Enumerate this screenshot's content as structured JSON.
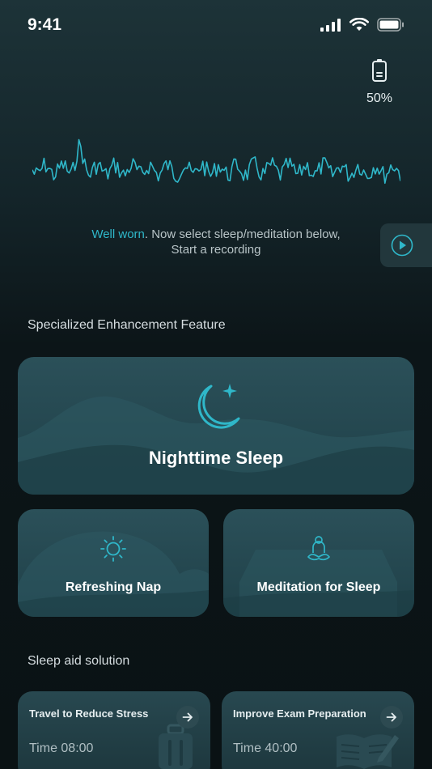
{
  "status_bar": {
    "time": "9:41"
  },
  "device": {
    "battery_percent": "50%"
  },
  "prompt": {
    "highlight": "Well worn",
    "line1_rest": ". Now select sleep/meditation below,",
    "line2": "Start a recording"
  },
  "sections": {
    "enhancement_title": "Specialized Enhancement Feature",
    "solution_title": "Sleep aid solution"
  },
  "features": {
    "nighttime": {
      "label": "Nighttime Sleep"
    },
    "nap": {
      "label": "Refreshing Nap"
    },
    "meditation": {
      "label": "Meditation for Sleep"
    }
  },
  "solutions": [
    {
      "title": "Travel to Reduce Stress",
      "time": "Time 08:00"
    },
    {
      "title": "Improve Exam Preparation",
      "time": "Time 40:00"
    }
  ],
  "colors": {
    "accent": "#2fb7c9",
    "card": "#24474f",
    "background": "#0c1518"
  },
  "icons": {
    "battery": "battery-icon",
    "play": "play-icon",
    "moon": "moon-star-icon",
    "sun": "sun-icon",
    "meditation": "meditation-icon",
    "arrow": "arrow-right-icon"
  }
}
